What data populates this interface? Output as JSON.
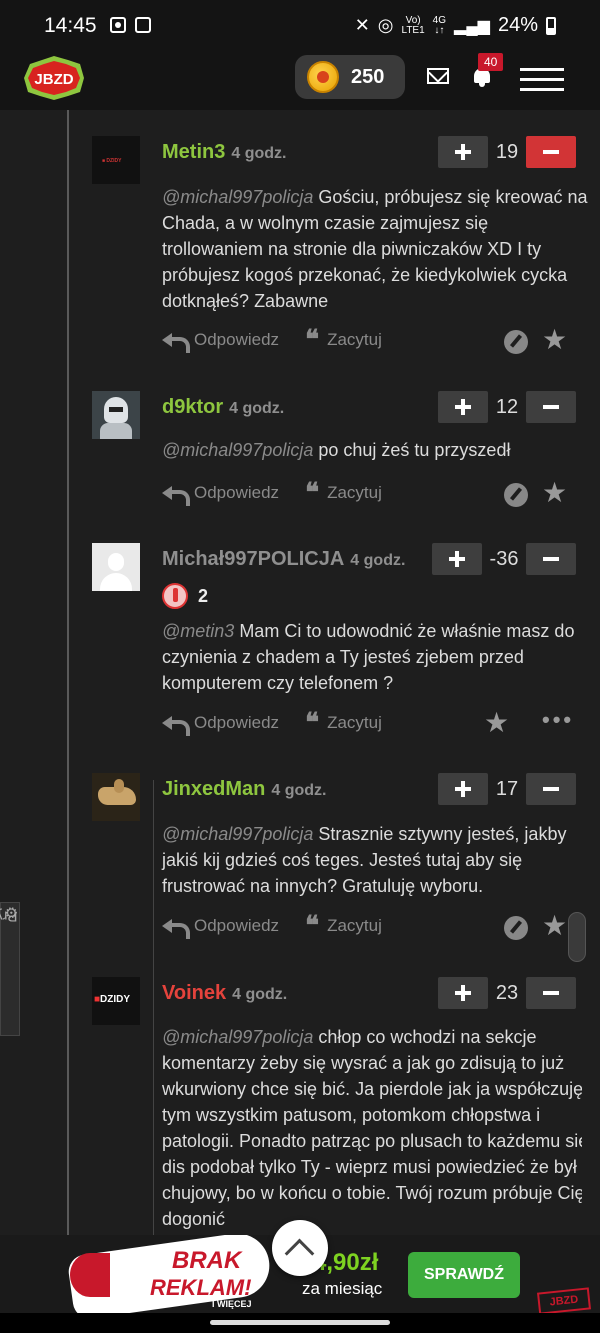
{
  "status": {
    "time": "14:45",
    "net_top": "Vo)",
    "net_bottom": "LTE1",
    "gen": "4G",
    "battery": "24%"
  },
  "header": {
    "logo_text": "JBZD",
    "coins": "250",
    "notifications": "40"
  },
  "comments": [
    {
      "user": "Metin3",
      "time": "4 godz.",
      "score": "19",
      "mention": "@michal997policja",
      "text": " Gościu, próbujesz się kreować na Chada, a w wolnym czasie zajmujesz się trollowaniem na stronie dla piwniczaków XD I ty próbujesz kogoś przekonać, że kiedykolwiek cycka dotknąłeś? Zabawne",
      "reply": "Odpowiedz",
      "quote": "Zacytuj"
    },
    {
      "user": "d9ktor",
      "time": "4 godz.",
      "score": "12",
      "mention": "@michal997policja",
      "text": " po chuj żeś tu przyszedł",
      "reply": "Odpowiedz",
      "quote": "Zacytuj"
    },
    {
      "user": "Michał997POLICJA",
      "time": "4 godz.",
      "score": "-36",
      "reaction_count": "2",
      "mention": "@metin3",
      "text": " Mam Ci to udowodnić że właśnie masz do czynienia z chadem a Ty jesteś zjebem przed komputerem czy telefonem ?",
      "reply": "Odpowiedz",
      "quote": "Zacytuj"
    },
    {
      "user": "JinxedMan",
      "time": "4 godz.",
      "score": "17",
      "mention": "@michal997policja",
      "text": " Strasznie sztywny jesteś, jakby jakiś kij gdzieś coś teges. Jesteś tutaj aby się frustrować na innych? Gratuluję wyboru.",
      "reply": "Odpowiedz",
      "quote": "Zacytuj"
    },
    {
      "user": "Voinek",
      "time": "4 godz.",
      "score": "23",
      "avatar_text": "DZIDY",
      "mention": "@michal997policja",
      "text": " chłop co wchodzi na sekcje komentarzy żeby się wysrać a jak go zdisują to już wkurwiony chce się bić. Ja pierdole jak ja współczuję tym wszystkim patusom, potomkom chłopstwa i patologii. Ponadto patrząc po plusach to każdemu się dis podobał tylko Ty - wieprz musi powiedzieć że był chujowy, bo w końcu o tobie. Twój rozum próbuje Cię dogonić"
    }
  ],
  "privacy_tab": "Prywatność",
  "ad": {
    "line1": "BRAK",
    "line2": "REKLAM!",
    "line3": "I WIĘCEJ",
    "price": "4,90zł",
    "per": "za miesiąc",
    "cta": "SPRAWDŹ",
    "mini_logo": "JBZD"
  }
}
